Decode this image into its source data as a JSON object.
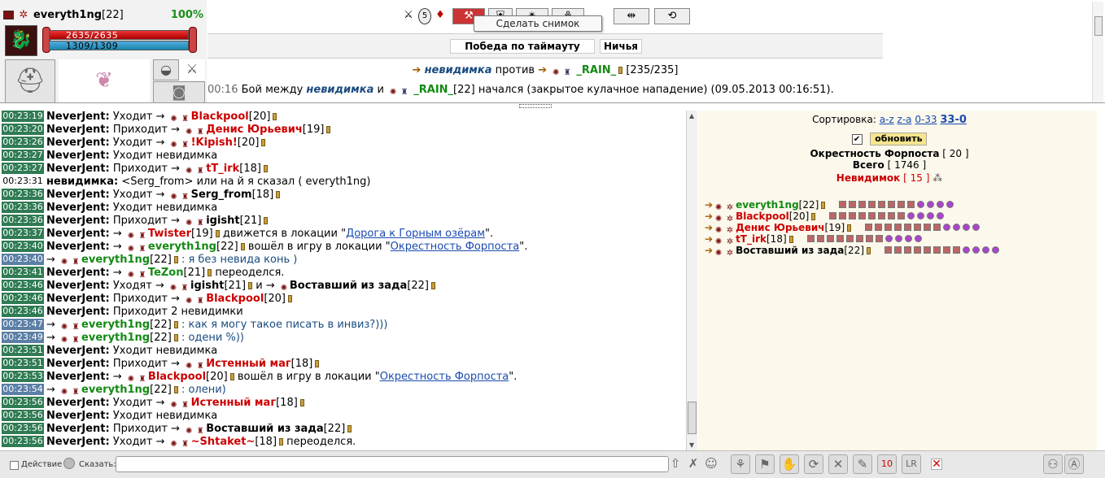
{
  "character": {
    "name": "everyth1ng",
    "level": "[22]",
    "hp_percent": "100%",
    "hp": "2635/2635",
    "mp": "1309/1309"
  },
  "tooltip": "Сделать снимок страницы",
  "fight": {
    "btn_timeout": "Победа по таймауту",
    "btn_draw": "Ничья",
    "line_a": "невидимка",
    "line_vs": "против",
    "line_b": "_RAIN_",
    "line_hp": "[235/235]",
    "log_time": "00:16",
    "log_text1": "Бой между",
    "log_name1": "невидимка",
    "log_and": "и",
    "log_name2": "_RAIN_",
    "log_level2": "[22]",
    "log_text2": "начался (закрытое кулачное нападение) (09.05.2013 00:16:51)."
  },
  "chat": [
    {
      "ts": "00:23:19",
      "a": "NeverJent:",
      "b": "Уходит →",
      "n": "Blackpool",
      "l": "[20]",
      "nc": "red"
    },
    {
      "ts": "00:23:20",
      "a": "NeverJent:",
      "b": "Приходит →",
      "n": "Денис Юрьевич",
      "l": "[19]",
      "nc": "red"
    },
    {
      "ts": "00:23:26",
      "a": "NeverJent:",
      "b": "Уходит →",
      "n": "!Kipish!",
      "l": "[20]",
      "nc": "red"
    },
    {
      "ts": "00:23:27",
      "a": "NeverJent:",
      "b": "Уходит невидимка",
      "n": "",
      "l": "",
      "nc": ""
    },
    {
      "ts": "00:23:27",
      "a": "NeverJent:",
      "b": "Приходит →",
      "n": "tT_irk",
      "l": "[18]",
      "nc": "red"
    },
    {
      "ts": "00:23:31",
      "a": "невидимка:",
      "b": "<Serg_from> или на      й я сказал ( everyth1ng)",
      "n": "",
      "l": "",
      "nc": "",
      "plain": true
    },
    {
      "ts": "00:23:36",
      "a": "NeverJent:",
      "b": "Уходит →",
      "n": "Serg_from",
      "l": "[18]",
      "nc": "black"
    },
    {
      "ts": "00:23:36",
      "a": "NeverJent:",
      "b": "Уходит невидимка",
      "n": "",
      "l": "",
      "nc": ""
    },
    {
      "ts": "00:23:36",
      "a": "NeverJent:",
      "b": "Приходит →",
      "n": "igisht",
      "l": "[21]",
      "nc": "black"
    },
    {
      "ts": "00:23:37",
      "a": "NeverJent:",
      "b": "→",
      "n": "Twister",
      "l": "[19]",
      "nc": "red",
      "tail": "движется в локации \"",
      "link": "Дорога к Горным озёрам",
      "tail2": "\"."
    },
    {
      "ts": "00:23:40",
      "a": "NeverJent:",
      "b": "→",
      "n": "everyth1ng",
      "l": "[22]",
      "nc": "green",
      "tail": "вошёл в игру в локации \"",
      "link": "Окрестность Форпоста",
      "tail2": "\"."
    },
    {
      "ts": "00:23:40",
      "a": "",
      "b": "→",
      "n": "everyth1ng",
      "l": "[22]",
      "nc": "green",
      "tail": ": я без невида конь )",
      "blue": true
    },
    {
      "ts": "00:23:41",
      "a": "NeverJent:",
      "b": "→",
      "n": "TeZon",
      "l": "[21]",
      "nc": "green",
      "tail": "переоделся."
    },
    {
      "ts": "00:23:46",
      "a": "NeverJent:",
      "b": "Уходят →",
      "n": "igisht",
      "l": "[21]",
      "nc": "black",
      "tail": "и →",
      "n2": "Воставший из зада",
      "l2": "[22]"
    },
    {
      "ts": "00:23:46",
      "a": "NeverJent:",
      "b": "Приходит →",
      "n": "Blackpool",
      "l": "[20]",
      "nc": "red"
    },
    {
      "ts": "00:23:46",
      "a": "NeverJent:",
      "b": "Приходит 2 невидимки",
      "n": "",
      "l": "",
      "nc": ""
    },
    {
      "ts": "00:23:47",
      "a": "",
      "b": "→",
      "n": "everyth1ng",
      "l": "[22]",
      "nc": "green",
      "tail": ": как я могу такое писать в инвиз?)))",
      "blue": true
    },
    {
      "ts": "00:23:49",
      "a": "",
      "b": "→",
      "n": "everyth1ng",
      "l": "[22]",
      "nc": "green",
      "tail": ": одени %))",
      "blue": true
    },
    {
      "ts": "00:23:51",
      "a": "NeverJent:",
      "b": "Уходит невидимка",
      "n": "",
      "l": "",
      "nc": ""
    },
    {
      "ts": "00:23:51",
      "a": "NeverJent:",
      "b": "Приходит →",
      "n": "Истенный маг",
      "l": "[18]",
      "nc": "red"
    },
    {
      "ts": "00:23:53",
      "a": "NeverJent:",
      "b": "→",
      "n": "Blackpool",
      "l": "[20]",
      "nc": "red",
      "tail": "вошёл в игру в локации \"",
      "link": "Окрестность Форпоста",
      "tail2": "\"."
    },
    {
      "ts": "00:23:54",
      "a": "",
      "b": "→",
      "n": "everyth1ng",
      "l": "[22]",
      "nc": "green",
      "tail": ": олени)",
      "blue": true
    },
    {
      "ts": "00:23:56",
      "a": "NeverJent:",
      "b": "Уходит →",
      "n": "Истенный маг",
      "l": "[18]",
      "nc": "red"
    },
    {
      "ts": "00:23:56",
      "a": "NeverJent:",
      "b": "Уходит невидимка",
      "n": "",
      "l": "",
      "nc": ""
    },
    {
      "ts": "00:23:56",
      "a": "NeverJent:",
      "b": "Приходит →",
      "n": "Воставший из зада",
      "l": "[22]",
      "nc": "black"
    },
    {
      "ts": "00:23:56",
      "a": "NeverJent:",
      "b": "Уходит →",
      "n": "~Shtaket~",
      "l": "[18]",
      "nc": "red",
      "tail": "переоделся."
    }
  ],
  "users": {
    "sort_label": "Сортировка:",
    "sort_az": "a-z",
    "sort_za": "z-a",
    "sort_033": "0-33",
    "sort_330": "33-0",
    "refresh": "обновить",
    "location_name": "Окрестность Форпоста",
    "location_count": "[ 20 ]",
    "total_label": "Всего",
    "total_count": "[ 1746 ]",
    "invis_label": "Невидимок",
    "invis_count": "[ 15 ]",
    "list": [
      {
        "n": "everyth1ng",
        "l": "[22]",
        "c": "green"
      },
      {
        "n": "Blackpool",
        "l": "[20]",
        "c": "red"
      },
      {
        "n": "Денис Юрьевич",
        "l": "[19]",
        "c": "red"
      },
      {
        "n": "tT_irk",
        "l": "[18]",
        "c": "red"
      },
      {
        "n": "Воставший из зада",
        "l": "[22]",
        "c": "black"
      }
    ]
  },
  "bottom": {
    "action_label": "Действие",
    "say_label": "Сказать:",
    "say_value": ""
  }
}
